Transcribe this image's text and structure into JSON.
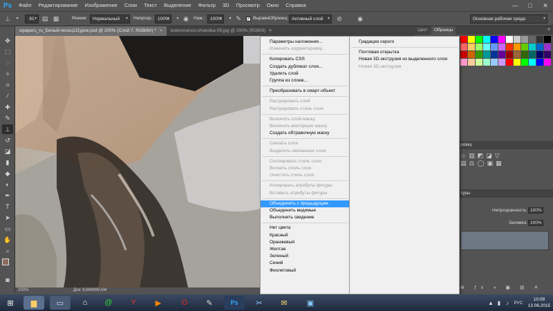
{
  "app": {
    "logo": "Ps",
    "accent": "#31a8ff"
  },
  "menu": [
    "Файл",
    "Редактирование",
    "Изображение",
    "Слои",
    "Текст",
    "Выделение",
    "Фильтр",
    "3D",
    "Просмотр",
    "Окно",
    "Справка"
  ],
  "window_controls": [
    "—",
    "□",
    "✕"
  ],
  "options": {
    "brush_size": "81",
    "mode_label": "Режим:",
    "mode_value": "Нормальный",
    "opacity_label": "Непрозр.:",
    "opacity_value": "100%",
    "pressure_label": "Наж.:",
    "pressure_value": "100%",
    "sample_label": "Выравн.",
    "source_label": "Образец:",
    "source_value": "Активный слой",
    "workspace": "Основная рабочая среда"
  },
  "tabs": [
    {
      "label": "wpapers_ru_Белый-песец111урок.psd @ 200% (Слой 7, RGB/8#) *",
      "close": "×",
      "active": true
    },
    {
      "label": "krahovcenco-chukotka-09.jpg @ 200% (RGB/8)",
      "close": "×",
      "active": false
    }
  ],
  "status": {
    "zoom": "200%",
    "doc": "Док: 8,66M/89,6M"
  },
  "panels": {
    "color_tab": "Цвет",
    "swatches_tab": "Образцы",
    "correction_partial": "ровку",
    "layers_partial": "туры",
    "opacity_label": "Непрозрачность:",
    "opacity_value": "100%",
    "fill_label": "Заливка:",
    "fill_value": "100%"
  },
  "context_menu": {
    "items": [
      {
        "label": "Параметры наложения...",
        "disabled": false
      },
      {
        "label": "Изменить корректировку...",
        "disabled": true
      },
      {
        "sep": true
      },
      {
        "label": "Копировать CSS",
        "disabled": false
      },
      {
        "label": "Создать дубликат слоя...",
        "disabled": false
      },
      {
        "label": "Удалить слой",
        "disabled": false
      },
      {
        "label": "Группа из слоев...",
        "disabled": false
      },
      {
        "sep": true
      },
      {
        "label": "Преобразовать в смарт-объект",
        "disabled": false
      },
      {
        "sep": true
      },
      {
        "label": "Растрировать слой",
        "disabled": true
      },
      {
        "label": "Растрировать стиль слоя",
        "disabled": true
      },
      {
        "sep": true
      },
      {
        "label": "Включить слой-маску",
        "disabled": true
      },
      {
        "label": "Включить векторную маску",
        "disabled": true
      },
      {
        "label": "Создать обтравочную маску",
        "disabled": false
      },
      {
        "sep": true
      },
      {
        "label": "Связать слои",
        "disabled": true
      },
      {
        "label": "Выделить связанные слои",
        "disabled": true
      },
      {
        "sep": true
      },
      {
        "label": "Скопировать стиль слоя",
        "disabled": true
      },
      {
        "label": "Вклеить стиль слоя",
        "disabled": true
      },
      {
        "label": "Очистить стиль слоя",
        "disabled": true
      },
      {
        "sep": true
      },
      {
        "label": "Копировать атрибуты фигуры",
        "disabled": true
      },
      {
        "label": "Вставить атрибуты фигуры",
        "disabled": true
      },
      {
        "sep": true
      },
      {
        "label": "Объединить с предыдущим",
        "disabled": false,
        "highlight": true
      },
      {
        "label": "Объединить видимые",
        "disabled": false
      },
      {
        "label": "Выполнить сведение",
        "disabled": false
      },
      {
        "sep": true
      },
      {
        "label": "Нет цвета",
        "disabled": false
      },
      {
        "label": "Красный",
        "disabled": false
      },
      {
        "label": "Оранжевый",
        "disabled": false
      },
      {
        "label": "Желтая",
        "disabled": false
      },
      {
        "label": "Зеленый",
        "disabled": false
      },
      {
        "label": "Синий",
        "disabled": false
      },
      {
        "label": "Фиолетовый",
        "disabled": false
      }
    ]
  },
  "submenu": {
    "items": [
      {
        "label": "Градации серого",
        "disabled": false
      },
      {
        "sep": true
      },
      {
        "label": "Почтовая открытка",
        "disabled": false
      },
      {
        "label": "Новая 3D-экструзия из выделенного слоя",
        "disabled": false
      },
      {
        "label": "Новая 3D-экструзия",
        "disabled": true
      }
    ]
  },
  "taskbar": {
    "lang": "РУС",
    "time": "10:09",
    "date": "13.06.2015"
  }
}
